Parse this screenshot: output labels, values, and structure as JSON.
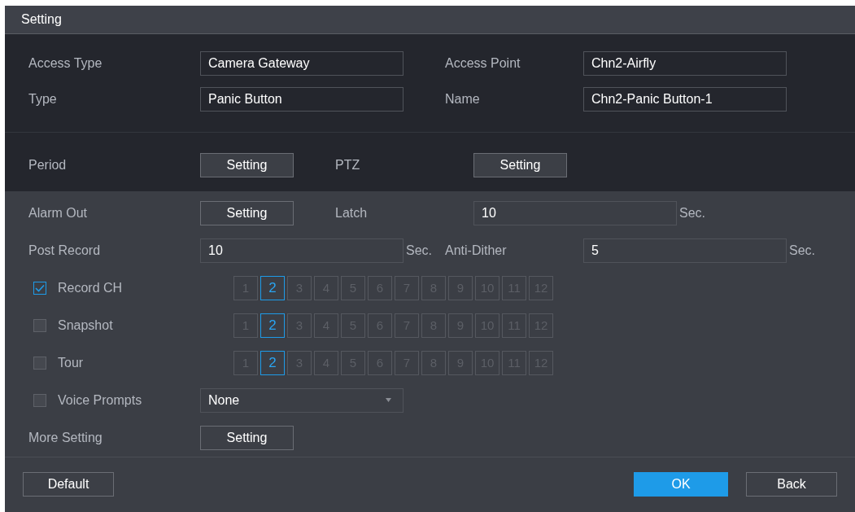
{
  "title": "Setting",
  "sections": [
    {
      "rows": [
        {
          "left": {
            "kind": "field",
            "label": "Access Type",
            "value": "Camera Gateway"
          },
          "right": {
            "kind": "field",
            "label": "Access Point",
            "value": "Chn2-Airfly"
          }
        },
        {
          "left": {
            "kind": "field",
            "label": "Type",
            "value": "Panic Button"
          },
          "right": {
            "kind": "field",
            "label": "Name",
            "value": "Chn2-Panic Button-1"
          }
        },
        {
          "left": {
            "kind": "button",
            "label": "Period",
            "button": "Setting"
          },
          "right": {
            "kind": "button",
            "label": "PTZ",
            "button": "Setting"
          }
        }
      ]
    },
    {
      "rows": [
        {
          "left": {
            "kind": "button",
            "label": "Alarm Out",
            "button": "Setting"
          },
          "right": {
            "kind": "field",
            "label": "Latch",
            "value": "10",
            "unit": "Sec."
          }
        },
        {
          "left": {
            "kind": "field",
            "label": "Post Record",
            "value": "10",
            "unit": "Sec."
          },
          "right": {
            "kind": "field",
            "label": "Anti-Dither",
            "value": "5",
            "unit": "Sec."
          }
        },
        {
          "left": {
            "kind": "channels",
            "label": "Record CH",
            "checked": true,
            "channels": [
              {
                "label": "1",
                "selected": false
              },
              {
                "label": "2",
                "selected": true
              },
              {
                "label": "3",
                "selected": false
              },
              {
                "label": "4",
                "selected": false
              },
              {
                "label": "5",
                "selected": false
              },
              {
                "label": "6",
                "selected": false
              },
              {
                "label": "7",
                "selected": false
              },
              {
                "label": "8",
                "selected": false
              },
              {
                "label": "9",
                "selected": false
              },
              {
                "label": "10",
                "selected": false
              },
              {
                "label": "11",
                "selected": false
              },
              {
                "label": "12",
                "selected": false
              }
            ]
          }
        },
        {
          "left": {
            "kind": "channels",
            "label": "Snapshot",
            "checked": false,
            "channels": [
              {
                "label": "1",
                "selected": false
              },
              {
                "label": "2",
                "selected": true
              },
              {
                "label": "3",
                "selected": false
              },
              {
                "label": "4",
                "selected": false
              },
              {
                "label": "5",
                "selected": false
              },
              {
                "label": "6",
                "selected": false
              },
              {
                "label": "7",
                "selected": false
              },
              {
                "label": "8",
                "selected": false
              },
              {
                "label": "9",
                "selected": false
              },
              {
                "label": "10",
                "selected": false
              },
              {
                "label": "11",
                "selected": false
              },
              {
                "label": "12",
                "selected": false
              }
            ]
          }
        },
        {
          "left": {
            "kind": "channels",
            "label": "Tour",
            "checked": false,
            "channels": [
              {
                "label": "1",
                "selected": false
              },
              {
                "label": "2",
                "selected": true
              },
              {
                "label": "3",
                "selected": false
              },
              {
                "label": "4",
                "selected": false
              },
              {
                "label": "5",
                "selected": false
              },
              {
                "label": "6",
                "selected": false
              },
              {
                "label": "7",
                "selected": false
              },
              {
                "label": "8",
                "selected": false
              },
              {
                "label": "9",
                "selected": false
              },
              {
                "label": "10",
                "selected": false
              },
              {
                "label": "11",
                "selected": false
              },
              {
                "label": "12",
                "selected": false
              }
            ]
          }
        },
        {
          "left": {
            "kind": "select",
            "label": "Voice Prompts",
            "checked": false,
            "value": "None"
          }
        },
        {
          "left": {
            "kind": "button",
            "label": "More Setting",
            "button": "Setting"
          }
        }
      ]
    }
  ],
  "footer": [
    {
      "label": "Default",
      "kind": "normal"
    },
    {
      "label": "OK",
      "kind": "primary"
    },
    {
      "label": "Back",
      "kind": "normal"
    }
  ]
}
